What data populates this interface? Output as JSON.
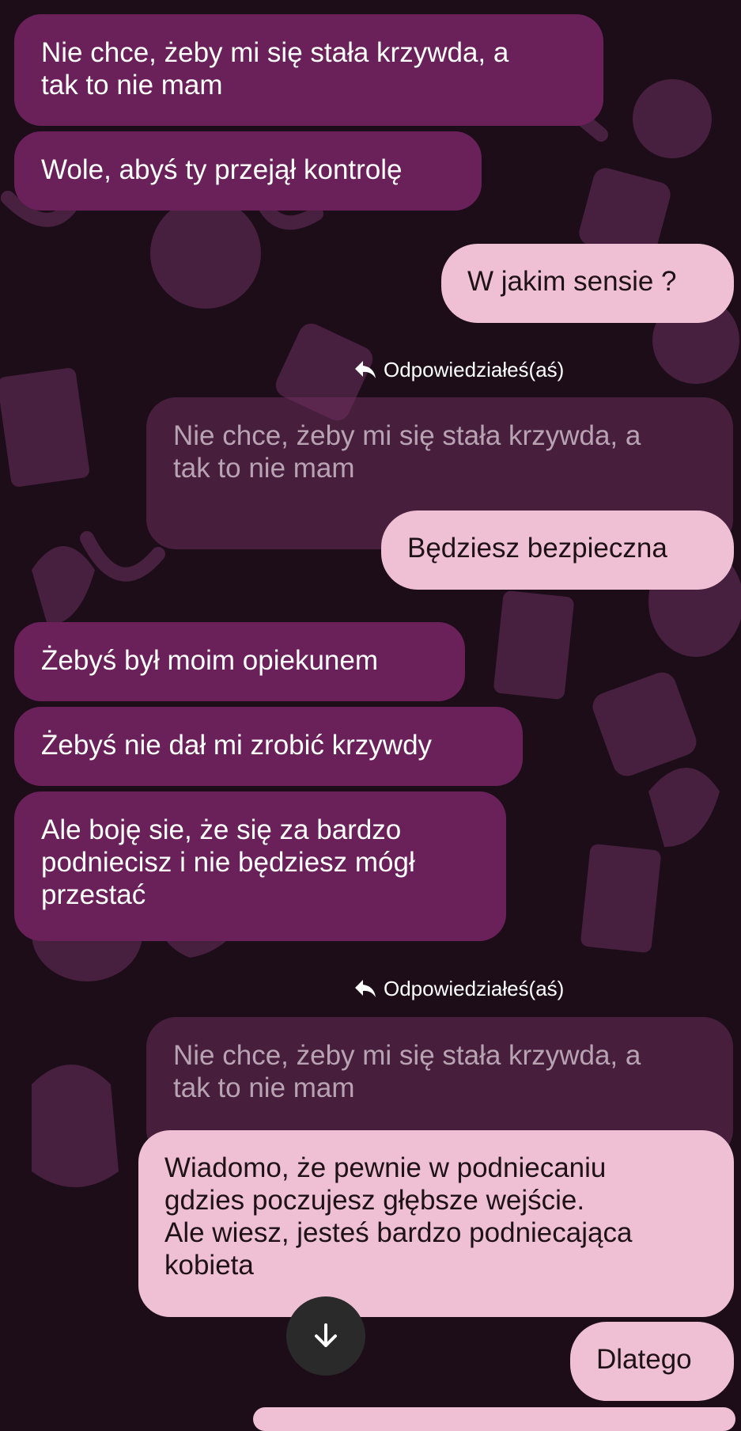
{
  "messages": [
    {
      "direction": "incoming",
      "text": "Nie chce, żeby mi się stała krzywda, a\ntak to nie mam"
    },
    {
      "direction": "incoming",
      "text": "Wole, abyś ty przejął kontrolę"
    },
    {
      "direction": "outgoing",
      "text": "W jakim sensie ?"
    },
    {
      "direction": "outgoing",
      "reply_label": "Odpowiedziałeś(aś)",
      "quoted": "Nie chce, żeby mi się stała krzywda, a\ntak to nie mam",
      "text": "Będziesz bezpieczna"
    },
    {
      "direction": "incoming",
      "text": "Żebyś był moim opiekunem"
    },
    {
      "direction": "incoming",
      "text": "Żebyś nie dał mi zrobić krzywdy"
    },
    {
      "direction": "incoming",
      "text": "Ale boję sie, że się za bardzo\npodniecisz i nie będziesz mógł\nprzestać"
    },
    {
      "direction": "outgoing",
      "reply_label": "Odpowiedziałeś(aś)",
      "quoted": "Nie chce, żeby mi się stała krzywda, a\ntak to nie mam",
      "text": "Wiadomo, że pewnie w podniecaniu\ngdzies poczujesz głębsze wejście.\nAle wiesz, jesteś bardzo podniecająca\nkobieta"
    },
    {
      "direction": "outgoing",
      "text": "Dlatego"
    }
  ],
  "controls": {
    "scroll_down_icon": "arrow-down-icon"
  },
  "colors": {
    "background": "#1c0d18",
    "incoming_bubble": "#6a2159",
    "outgoing_bubble": "#efbfd4",
    "pattern": "#4a2140"
  }
}
